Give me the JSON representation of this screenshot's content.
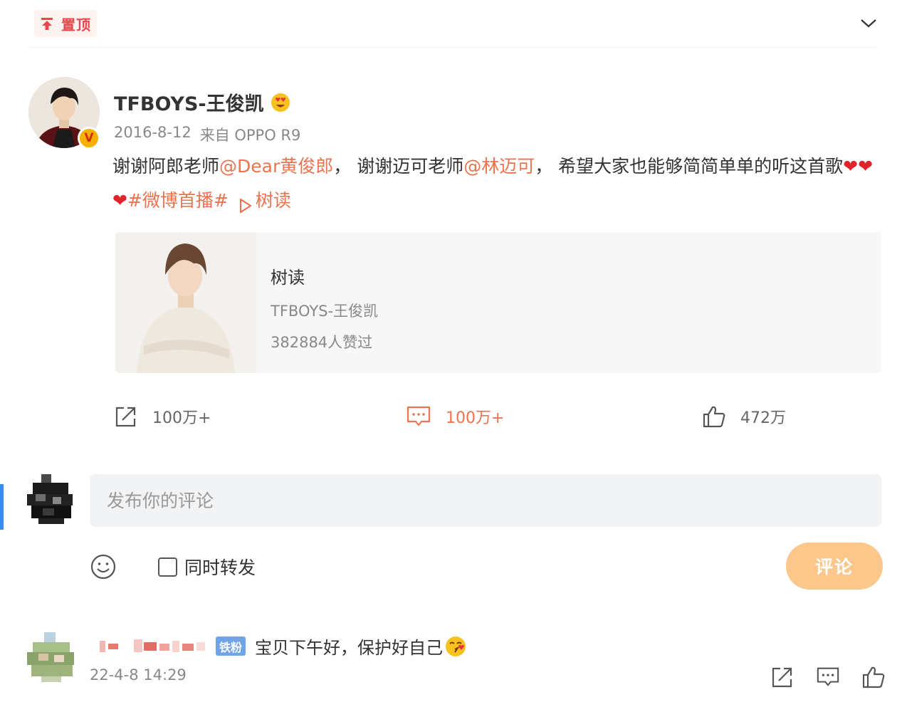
{
  "pin": {
    "label": "置顶",
    "icon": "pin-top-icon"
  },
  "post": {
    "author": "TFBOYS-王俊凯",
    "verified_mark": "V",
    "date": "2016-8-12",
    "source": "来自 OPPO R9",
    "text": {
      "part1": "谢谢阿郎老师",
      "mention1": "@Dear黄俊郎",
      "part2": "，  谢谢迈可老师",
      "mention2": "@林迈可",
      "part3": "，  希望大家也能够简简单单的听这首歌",
      "hearts": "❤❤❤",
      "topic": "#微博首播#",
      "song_link": "树读"
    },
    "music_card": {
      "title": "树读",
      "artist": "TFBOYS-王俊凯",
      "likes": "382884人赞过"
    },
    "actions": {
      "repost_count": "100万+",
      "comment_count": "100万+",
      "like_count": "472万"
    }
  },
  "composer": {
    "placeholder": "发布你的评论",
    "repost_label": "同时转发",
    "submit_label": "评论"
  },
  "first_comment": {
    "badge": "铁粉",
    "text": "宝贝下午好，保护好自己",
    "time": "22-4-8 14:29"
  },
  "colors": {
    "accent": "#eb7350",
    "pin_red": "#e8464a",
    "submit_disabled": "#fbc78a",
    "fan_badge": "#6fa5e8"
  }
}
